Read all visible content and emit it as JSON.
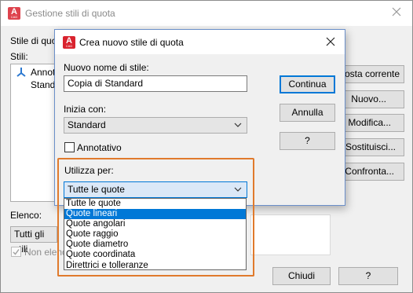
{
  "outer": {
    "title": "Gestione stili di quota",
    "current_style_label": "Stile di quota corrente: Standard",
    "styles_label": "Stili:",
    "styles": [
      "Annotativo",
      "Standard"
    ],
    "list_label": "Elenco:",
    "list_value": "Tutti gli stili",
    "exclude_label": "Non elencare stili nei xrif",
    "buttons": {
      "set_current": "Imposta corrente",
      "new": "Nuovo...",
      "modify": "Modifica...",
      "override": "Sostituisci...",
      "compare": "Confronta...",
      "close": "Chiudi",
      "help": "?"
    }
  },
  "dialog": {
    "title": "Crea nuovo stile di quota",
    "name_label": "Nuovo nome di stile:",
    "name_value": "Copia di Standard",
    "start_label": "Inizia con:",
    "start_value": "Standard",
    "annotative_label": "Annotativo",
    "use_for_label": "Utilizza per:",
    "use_for_value": "Tutte le quote",
    "buttons": {
      "continue": "Continua",
      "cancel": "Annulla",
      "help": "?"
    }
  },
  "dropdown": {
    "options": [
      "Tutte le quote",
      "Quote lineari",
      "Quote angolari",
      "Quote raggio",
      "Quote diametro",
      "Quote coordinata",
      "Direttrici e tolleranze"
    ],
    "selected": "Quote lineari"
  },
  "colors": {
    "highlight": "#e07a2c",
    "selection": "#0078d7",
    "app_logo": "#d9232e"
  },
  "icons": {
    "app": "autocad-logo-icon",
    "style": "annotative-style-icon",
    "close": "close-icon",
    "chevron": "chevron-down-icon"
  }
}
